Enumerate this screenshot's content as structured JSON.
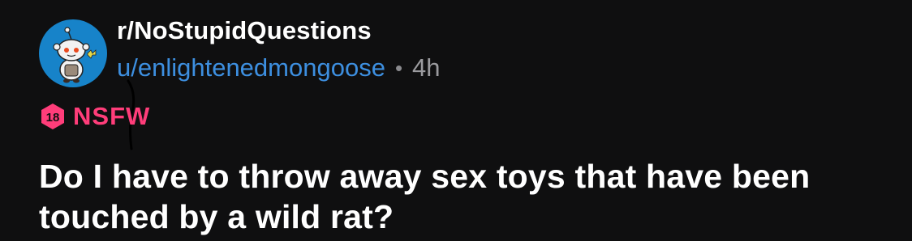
{
  "post": {
    "subreddit": "r/NoStupidQuestions",
    "username": "u/enlightenedmongoose",
    "separator": "•",
    "age": "4h",
    "nsfw_badge_number": "18",
    "nsfw_label": "NSFW",
    "title": "Do I have to throw away sex toys that have been touched by a wild rat?"
  },
  "colors": {
    "background": "#0f0f10",
    "username": "#3d8fe0",
    "nsfw": "#ff3d7a",
    "avatar_bg": "#1783c9"
  },
  "icons": {
    "avatar": "snoo-avatar-icon",
    "nsfw": "nsfw-18-icon"
  }
}
